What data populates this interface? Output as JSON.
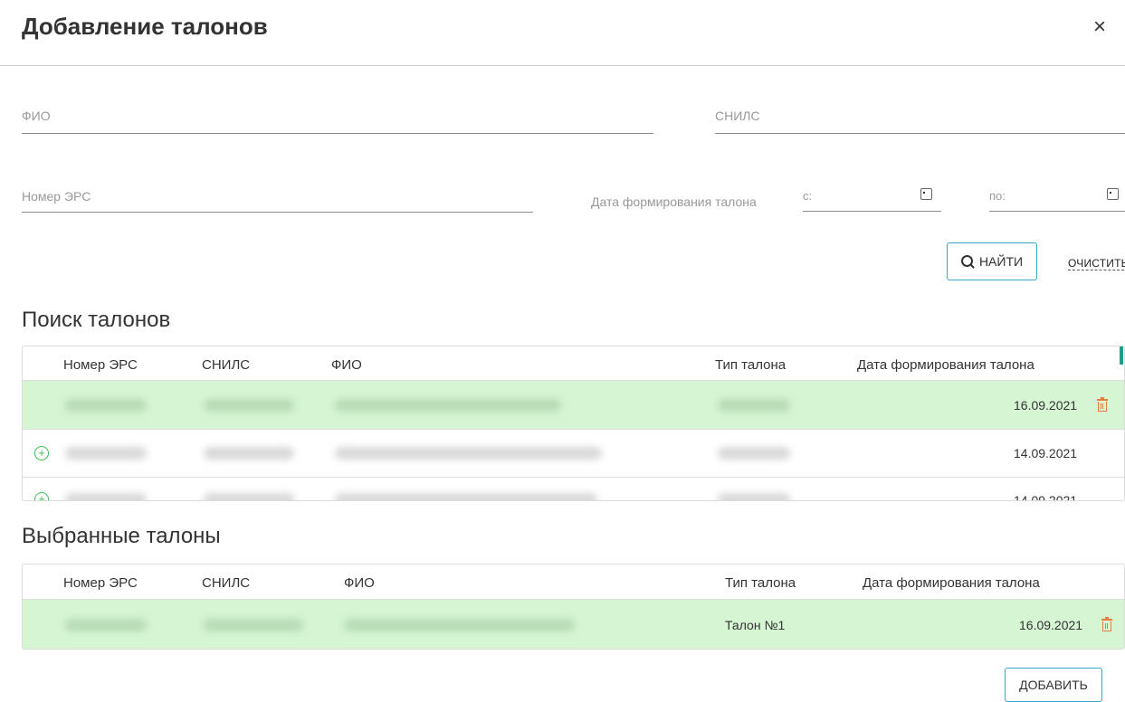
{
  "dialog": {
    "title": "Добавление талонов",
    "close_symbol": "×"
  },
  "filters": {
    "fio_placeholder": "ФИО",
    "snils_placeholder": "СНИЛС",
    "ers_placeholder": "Номер ЭРС",
    "date_label": "Дата формирования талона",
    "date_from_placeholder": "с:",
    "date_to_placeholder": "по:",
    "find_label": "НАЙТИ",
    "clear_label": "ОЧИСТИТЬ"
  },
  "search_section": {
    "title": "Поиск талонов",
    "columns": [
      "Номер ЭРС",
      "СНИЛС",
      "ФИО",
      "Тип талона",
      "Дата формирования талона"
    ],
    "rows": [
      {
        "date": "16.09.2021",
        "selected": true
      },
      {
        "date": "14.09.2021",
        "selected": false
      },
      {
        "date": "14.09.2021",
        "selected": false
      }
    ]
  },
  "selected_section": {
    "title": "Выбранные талоны",
    "columns": [
      "Номер ЭРС",
      "СНИЛС",
      "ФИО",
      "Тип талона",
      "Дата формирования талона"
    ],
    "rows": [
      {
        "type": "Талон №1",
        "date": "16.09.2021"
      }
    ]
  },
  "add_label": "ДОБАВИТЬ",
  "colors": {
    "accent": "#38a6c9",
    "selected_row": "#d5f5d3",
    "trash": "#f07a3e",
    "plus": "#3fbf4f"
  }
}
